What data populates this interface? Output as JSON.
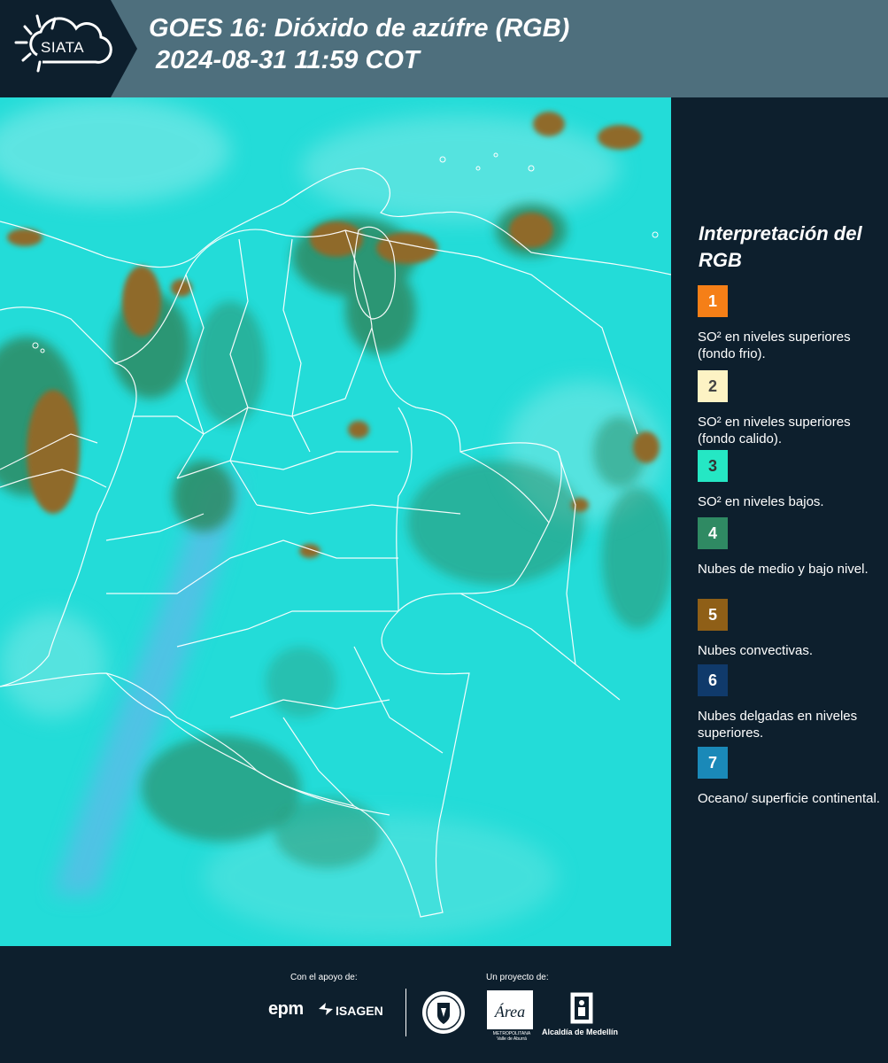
{
  "header": {
    "logo_text": "SIATA",
    "title_line1": "GOES 16: Dióxido de azúfre (RGB)",
    "title_line2": "2024-08-31 11:59 COT"
  },
  "legend": {
    "title": "Interpretación del RGB",
    "items": [
      {
        "number": "1",
        "label": "SO² en niveles superiores (fondo frio).",
        "color": "#f57f17",
        "text_color": "#ffffff"
      },
      {
        "number": "2",
        "label": "SO² en niveles superiores (fondo calido).",
        "color": "#fdf3c4",
        "text_color": "#444444"
      },
      {
        "number": "3",
        "label": "SO² en niveles bajos.",
        "color": "#25e7c4",
        "text_color": "#333333"
      },
      {
        "number": "4",
        "label": "Nubes de medio y bajo nivel.",
        "color": "#2f8a63",
        "text_color": "#ffffff"
      },
      {
        "number": "5",
        "label": "Nubes convectivas.",
        "color": "#8f5f17",
        "text_color": "#ffffff"
      },
      {
        "number": "6",
        "label": "Nubes delgadas en niveles superiores.",
        "color": "#103a6b",
        "text_color": "#ffffff"
      },
      {
        "number": "7",
        "label": "Oceano/ superficie continental.",
        "color": "#1a89b8",
        "text_color": "#ffffff"
      }
    ]
  },
  "footer": {
    "support_label": "Con el apoyo de:",
    "project_label": "Un proyecto de:",
    "epm": "epm",
    "isagen": "ISAGEN",
    "area_text": "METROPOLITANA Valle de Aburrá",
    "area_logo_text": "Área",
    "alcaldia": "Alcaldía de Medellín"
  },
  "colors": {
    "header_bg": "#4e6f7d",
    "panel_bg": "#0d1f2d",
    "land_cyan": "#23dcd8",
    "cloud_green": "#2f8a63",
    "cloud_brown": "#8f6a2a"
  }
}
